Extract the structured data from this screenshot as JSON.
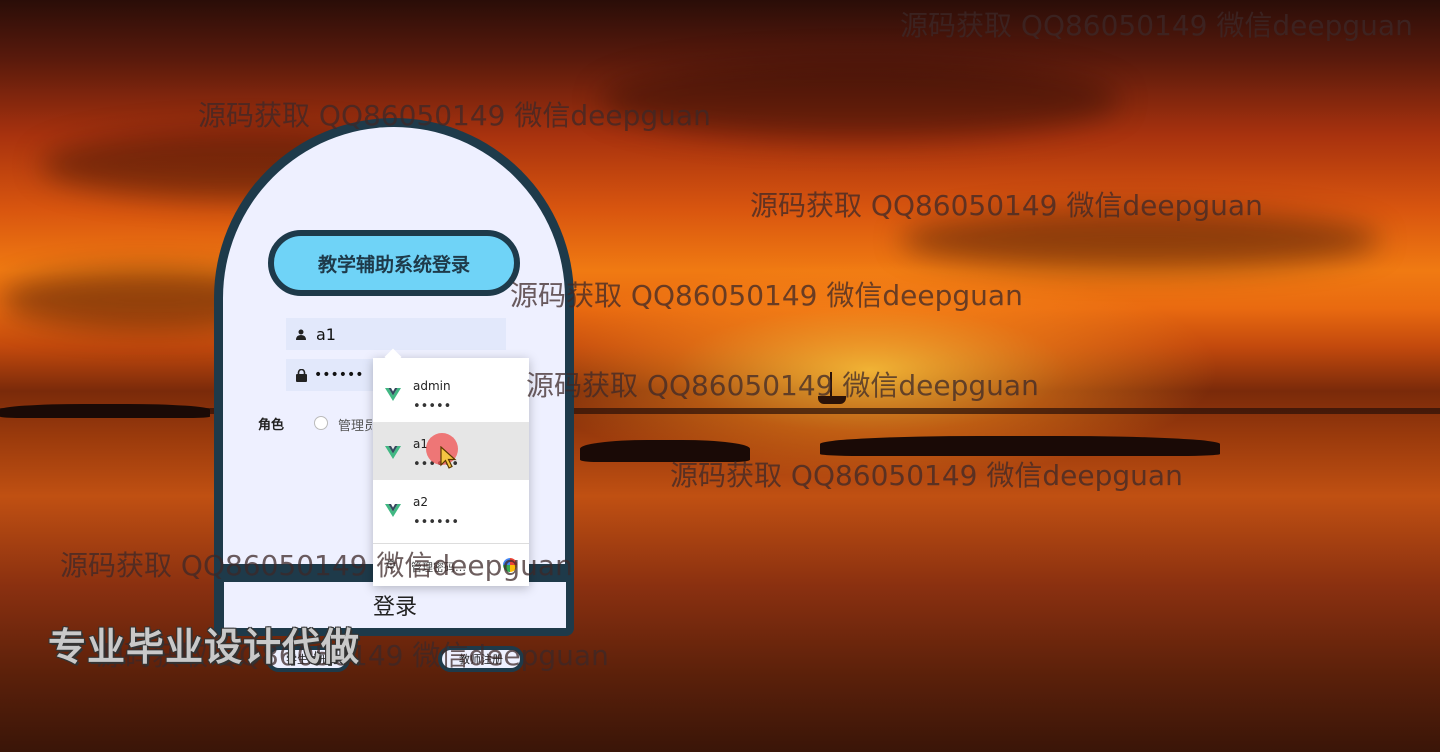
{
  "login": {
    "title": "教学辅助系统登录",
    "username_value": "a1",
    "password_value": "••••••",
    "role_label": "角色",
    "role_option": "管理员",
    "login_button": "登录",
    "student_register": "学生注册",
    "teacher_register": "教师注册"
  },
  "autofill": {
    "items": [
      {
        "user": "admin",
        "pass": "•••••"
      },
      {
        "user": "a1",
        "pass": "••••••"
      },
      {
        "user": "a2",
        "pass": "••••••"
      }
    ],
    "manage_label": "管理密码…"
  },
  "watermarks": {
    "text": "源码获取 QQ86050149 微信deepguan",
    "banner": "专业毕业设计代做"
  },
  "colors": {
    "card_border": "#1e3a4a",
    "title_bg": "#6fd3f7",
    "card_bg": "#eef0ff"
  }
}
